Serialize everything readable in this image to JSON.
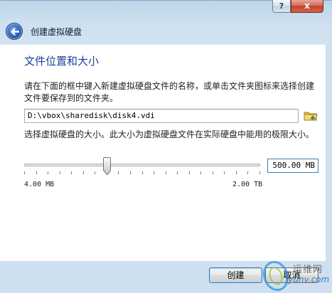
{
  "window": {
    "help_label": "?",
    "close_label": "x"
  },
  "header": {
    "title": "创建虚拟硬盘"
  },
  "section": {
    "title": "文件位置和大小",
    "location_description": "请在下面的框中键入新建虚拟硬盘文件的名称，或单击文件夹图标来选择创建文件要保存到的文件夹。",
    "file_path": "D:\\vbox\\sharedisk\\disk4.vdi",
    "size_description": "选择虚拟硬盘的大小。此大小为虚拟硬盘文件在实际硬盘中能用的极限大小。"
  },
  "size": {
    "value_text": "500.00 MB",
    "min_label": "4.00 MB",
    "max_label": "2.00 TB",
    "slider_fraction": 0.35
  },
  "buttons": {
    "create": "创建",
    "cancel": "取消"
  },
  "watermark": {
    "cn": "运维网",
    "url": "iyunv.com"
  },
  "colors": {
    "title_blue": "#1c3f95",
    "focus_border": "#3c7fb1",
    "close_red": "#c2432a"
  },
  "icons": [
    "back-arrow-icon",
    "folder-icon"
  ]
}
